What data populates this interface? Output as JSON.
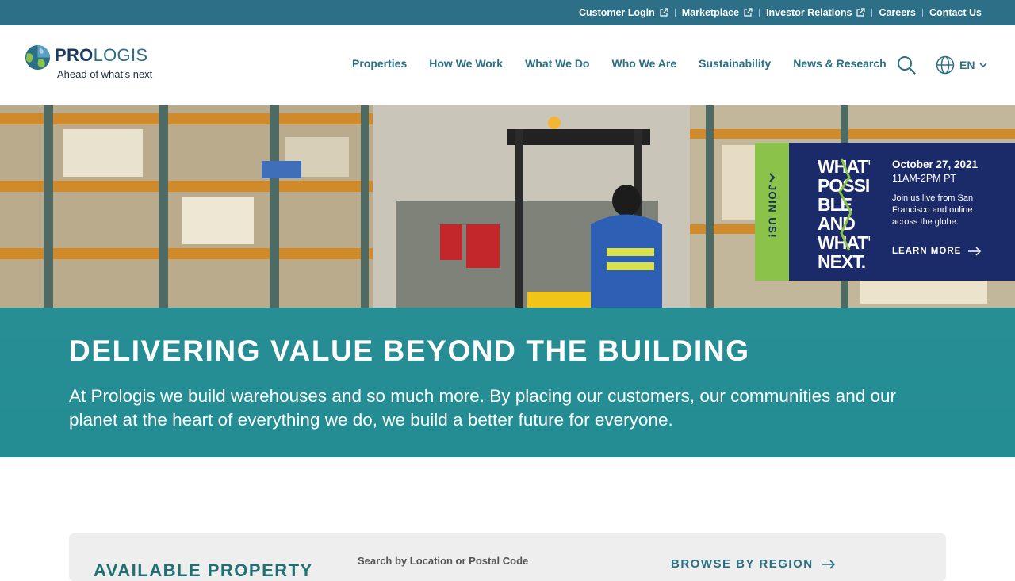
{
  "utility": {
    "links": [
      {
        "label": "Customer Login",
        "external": true
      },
      {
        "label": "Marketplace",
        "external": true
      },
      {
        "label": "Investor Relations",
        "external": true
      },
      {
        "label": "Careers",
        "external": false
      },
      {
        "label": "Contact Us",
        "external": false
      }
    ]
  },
  "brand": {
    "name_part1": "PRO",
    "name_part2": "LOGIS",
    "tagline": "Ahead of what's next"
  },
  "nav": {
    "items": [
      "Properties",
      "How We Work",
      "What We Do",
      "Who We Are",
      "Sustainability",
      "News & Research"
    ],
    "language": "EN"
  },
  "hero": {
    "title": "DELIVERING VALUE BEYOND THE BUILDING",
    "text": "At Prologis we build warehouses and so much more. By placing our customers, our communities and our planet at the heart of everything we do, we build a better future for everyone."
  },
  "promo": {
    "tab_label": "JOIN US!",
    "art_lines": [
      "WHAT'S",
      "POSSI-",
      "BLE",
      "AND",
      "WHAT'S",
      "NEXT."
    ],
    "date": "October 27, 2021",
    "time": "11AM-2PM PT",
    "description": "Join us live from San Francisco and online across the globe.",
    "cta": "LEARN MORE"
  },
  "property_search": {
    "title": "AVAILABLE PROPERTY",
    "search_label": "Search by Location or Postal Code",
    "browse_label": "BROWSE BY REGION"
  },
  "colors": {
    "utility_bar": "#2d6f87",
    "nav_text": "#2b6f84",
    "hero_band": "#1e9198",
    "promo_bg": "#1b2a68",
    "promo_tab": "#8bc34a"
  }
}
